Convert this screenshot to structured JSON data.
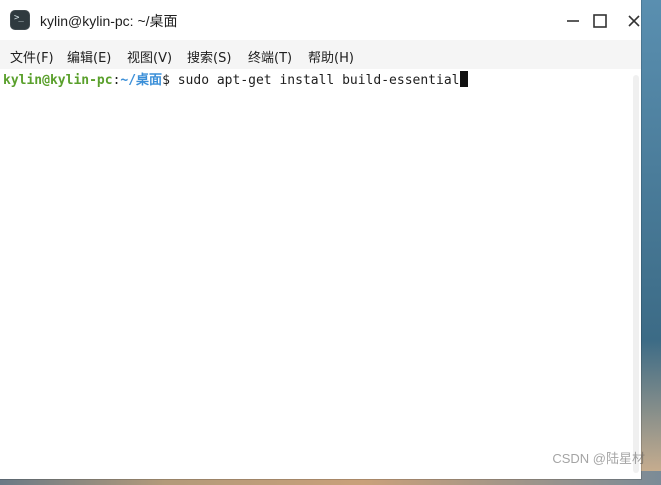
{
  "window": {
    "title": "kylin@kylin-pc: ~/桌面",
    "icon": "terminal-icon"
  },
  "menubar": {
    "items": [
      {
        "label": "文件(F)"
      },
      {
        "label": "编辑(E)"
      },
      {
        "label": "视图(V)"
      },
      {
        "label": "搜索(S)"
      },
      {
        "label": "终端(T)"
      },
      {
        "label": "帮助(H)"
      }
    ]
  },
  "terminal": {
    "prompt_user": "kylin@kylin-pc",
    "prompt_colon": ":",
    "prompt_path": "~/桌面",
    "prompt_symbol": "$",
    "command": "sudo apt-get install build-essential"
  },
  "watermark": "CSDN @陆星材",
  "colors": {
    "prompt_user": "#5aa02c",
    "prompt_path": "#3b8fd8",
    "titlebar": "#ffffff",
    "menubar": "#f5f5f5"
  }
}
